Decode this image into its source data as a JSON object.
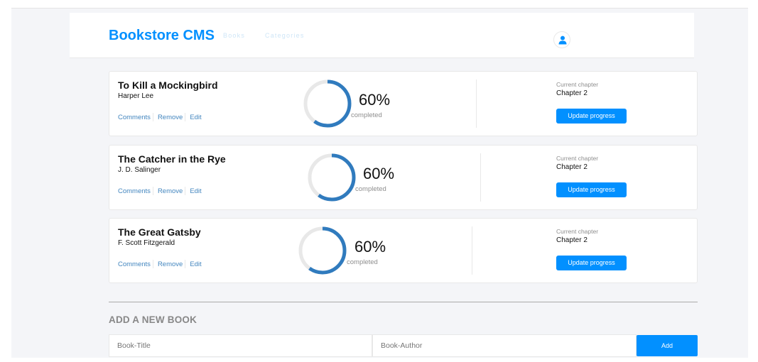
{
  "header": {
    "logo": "Bookstore CMS",
    "nav": [
      {
        "label": "Books"
      },
      {
        "label": "Categories"
      }
    ],
    "user_icon": "user-icon"
  },
  "books": [
    {
      "title": "To Kill a Mockingbird",
      "author": "Harper Lee",
      "actions": {
        "comments": "Comments",
        "remove": "Remove",
        "edit": "Edit"
      },
      "progress": 60,
      "percent_text": "60%",
      "completed_label": "completed",
      "chapter_label": "Current chapter",
      "chapter": "Chapter 2",
      "update_label": "Update progress"
    },
    {
      "title": "The Catcher in the Rye",
      "author": "J. D. Salinger",
      "actions": {
        "comments": "Comments",
        "remove": "Remove",
        "edit": "Edit"
      },
      "progress": 60,
      "percent_text": "60%",
      "completed_label": "completed",
      "chapter_label": "Current chapter",
      "chapter": "Chapter 2",
      "update_label": "Update progress"
    },
    {
      "title": "The Great Gatsby",
      "author": "F. Scott Fitzgerald",
      "actions": {
        "comments": "Comments",
        "remove": "Remove",
        "edit": "Edit"
      },
      "progress": 60,
      "percent_text": "60%",
      "completed_label": "completed",
      "chapter_label": "Current chapter",
      "chapter": "Chapter 2",
      "update_label": "Update progress"
    }
  ],
  "add_form": {
    "heading": "ADD A NEW BOOK",
    "title_placeholder": "Book-Title",
    "author_placeholder": "Book-Author",
    "add_label": "Add"
  },
  "colors": {
    "accent": "#0290ff",
    "progress": "#307bbe",
    "ring_track": "#e8e8e8",
    "link": "#4386bf"
  }
}
